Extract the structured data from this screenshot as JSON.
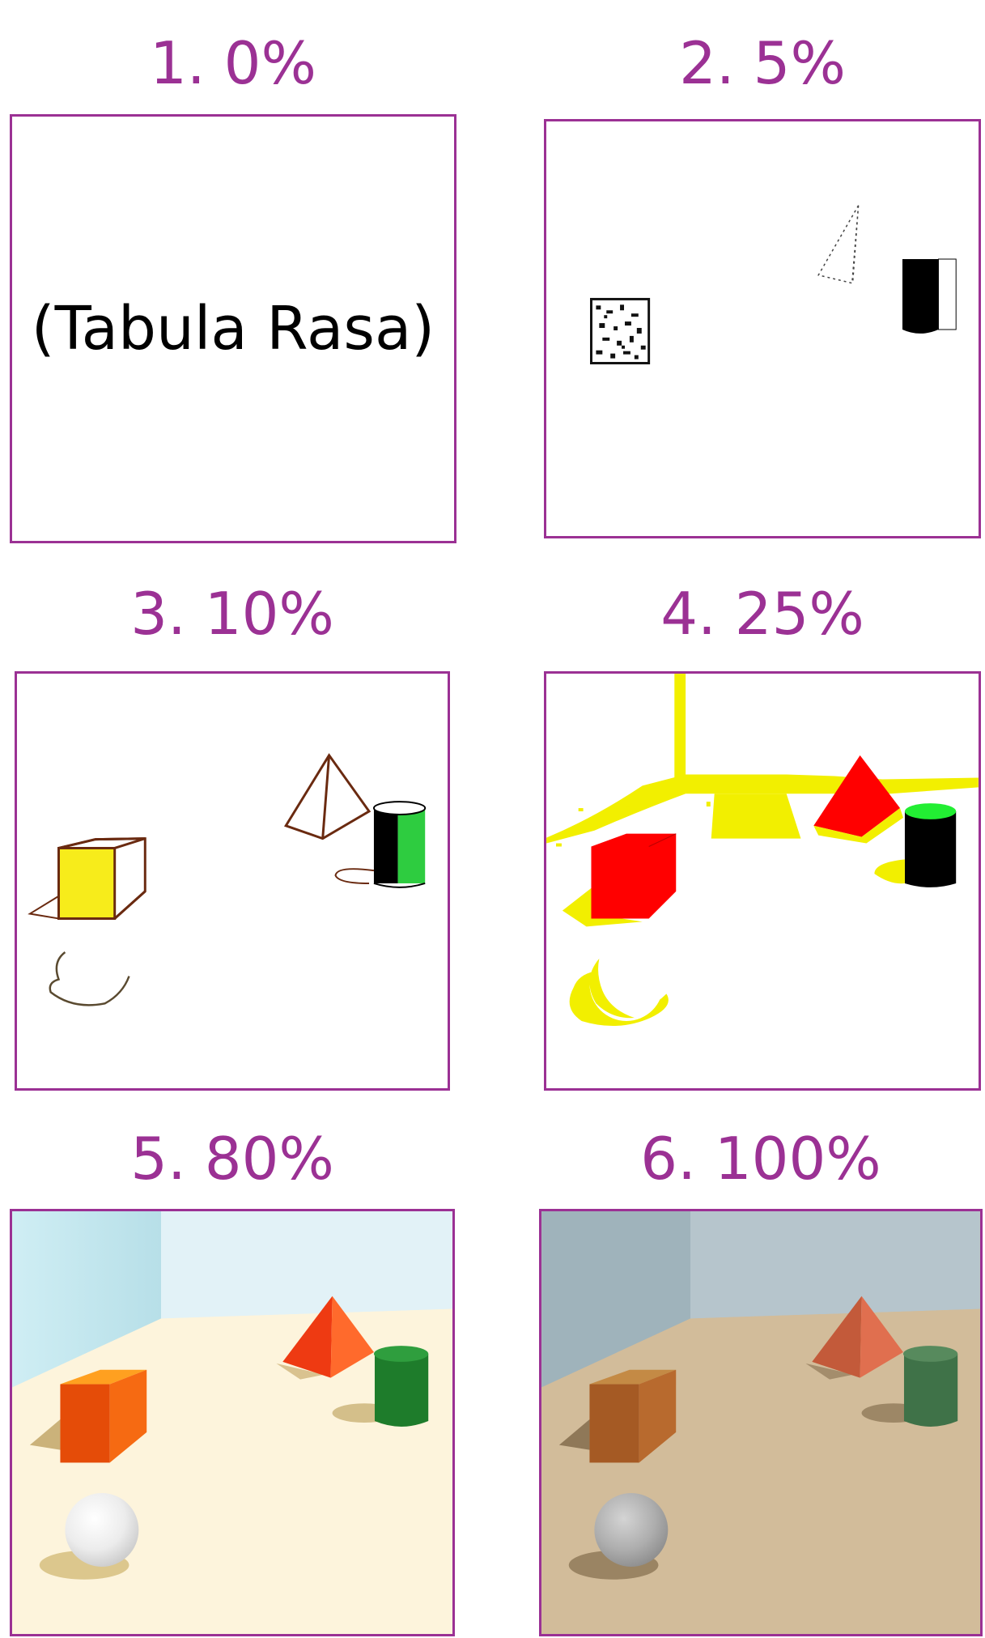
{
  "panels": [
    {
      "title": "1. 0%",
      "caption": "(Tabula Rasa)"
    },
    {
      "title": "2. 5%"
    },
    {
      "title": "3. 10%"
    },
    {
      "title": "4. 25%"
    },
    {
      "title": "5. 80%"
    },
    {
      "title": "6. 100%"
    }
  ],
  "colors": {
    "frame": "#9b3194",
    "title_text": "#9b3194"
  }
}
